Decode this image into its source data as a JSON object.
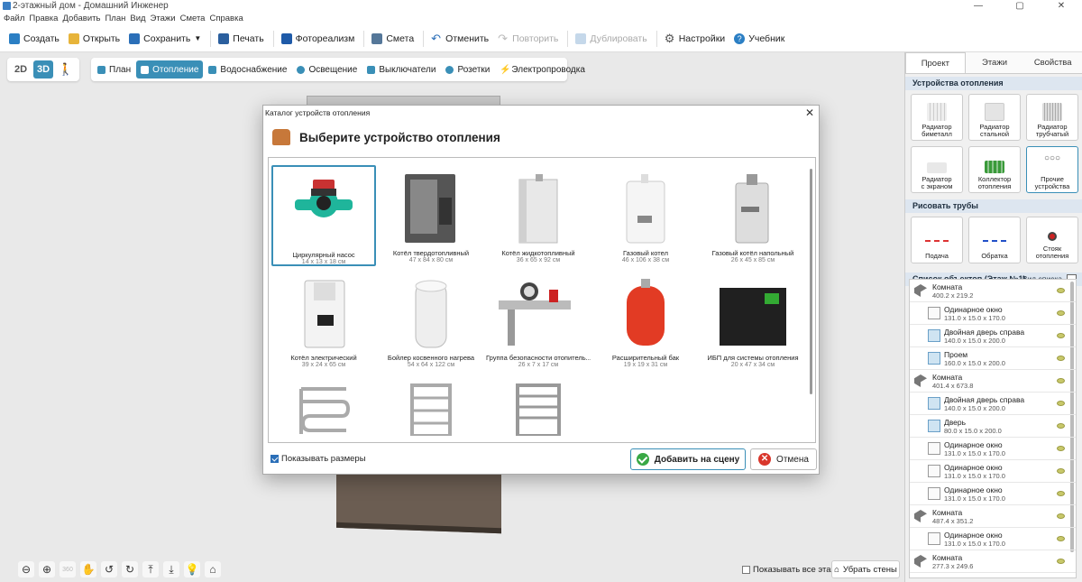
{
  "window": {
    "title": "2-этажный дом - Домашний Инженер",
    "controls": [
      "—",
      "▢",
      "✕"
    ]
  },
  "menu": [
    "Файл",
    "Правка",
    "Добавить",
    "План",
    "Вид",
    "Этажи",
    "Смета",
    "Справка"
  ],
  "toolbar": {
    "create": "Создать",
    "open": "Открыть",
    "save": "Сохранить",
    "print": "Печать",
    "photoreal": "Фотореализм",
    "estimate": "Смета",
    "undo": "Отменить",
    "redo": "Повторить",
    "duplicate": "Дублировать",
    "settings": "Настройки",
    "tutorial": "Учебник"
  },
  "views": {
    "v2d": "2D",
    "v3d": "3D"
  },
  "modes": [
    "План",
    "Отопление",
    "Водоснабжение",
    "Освещение",
    "Выключатели",
    "Розетки",
    "Электропроводка"
  ],
  "bottom": {
    "show_all_floors": "Показывать все этажи",
    "remove_walls": "Убрать стены",
    "rotate_label": "360"
  },
  "right": {
    "tabs": [
      "Проект",
      "Этажи",
      "Свойства"
    ],
    "devices_header": "Устройства отопления",
    "devices": [
      {
        "l1": "Радиатор",
        "l2": "биметалл"
      },
      {
        "l1": "Радиатор",
        "l2": "стальной"
      },
      {
        "l1": "Радиатор",
        "l2": "трубчатый"
      },
      {
        "l1": "Радиатор",
        "l2": "с экраном"
      },
      {
        "l1": "Коллектор",
        "l2": "отопления"
      },
      {
        "l1": "Прочие",
        "l2": "устройства"
      }
    ],
    "pipes_header": "Рисовать трубы",
    "pipes": [
      {
        "l1": "Подача",
        "l2": ""
      },
      {
        "l1": "Обратка",
        "l2": ""
      },
      {
        "l1": "Стояк",
        "l2": "отопления"
      }
    ],
    "objects_header": "Список объектов (Этаж №1)",
    "view_list": "Вид списка",
    "objects": [
      {
        "name": "Комната",
        "dim": "400.2 x 219.2",
        "kind": "room"
      },
      {
        "name": "Одинарное окно",
        "dim": "131.0 x 15.0 x 170.0",
        "kind": "child"
      },
      {
        "name": "Двойная дверь справа",
        "dim": "140.0 x 15.0 x 200.0",
        "kind": "door"
      },
      {
        "name": "Проем",
        "dim": "160.0 x 15.0 x 200.0",
        "kind": "door"
      },
      {
        "name": "Комната",
        "dim": "401.4 x 673.8",
        "kind": "room"
      },
      {
        "name": "Двойная дверь справа",
        "dim": "140.0 x 15.0 x 200.0",
        "kind": "door"
      },
      {
        "name": "Дверь",
        "dim": "80.0 x 15.0 x 200.0",
        "kind": "door"
      },
      {
        "name": "Одинарное окно",
        "dim": "131.0 x 15.0 x 170.0",
        "kind": "child"
      },
      {
        "name": "Одинарное окно",
        "dim": "131.0 x 15.0 x 170.0",
        "kind": "child"
      },
      {
        "name": "Одинарное окно",
        "dim": "131.0 x 15.0 x 170.0",
        "kind": "child"
      },
      {
        "name": "Комната",
        "dim": "487.4 x 351.2",
        "kind": "room"
      },
      {
        "name": "Одинарное окно",
        "dim": "131.0 x 15.0 x 170.0",
        "kind": "child"
      },
      {
        "name": "Комната",
        "dim": "277.3 x 249.6",
        "kind": "room"
      }
    ]
  },
  "dialog": {
    "title": "Каталог устройств отопления",
    "heading": "Выберите устройство отопления",
    "items": [
      {
        "name": "Циркулярный насос",
        "size": "14 x 13 x 18 см",
        "pic": "pump"
      },
      {
        "name": "Котёл твердотопливный",
        "size": "47 x 84 x 80 см",
        "pic": "solid"
      },
      {
        "name": "Котёл жидкотопливный",
        "size": "36 x 65 x 92 см",
        "pic": "liquid"
      },
      {
        "name": "Газовый котел",
        "size": "46 x 106 x 38 см",
        "pic": "gas"
      },
      {
        "name": "Газовый котёл напольный",
        "size": "26 x 45 x 85 см",
        "pic": "gasfloor"
      },
      {
        "name": "Котёл электрический",
        "size": "39 x 24 x 65 см",
        "pic": "electric"
      },
      {
        "name": "Бойлер косвенного нагрева",
        "size": "54 x 64 x 122 см",
        "pic": "boiler"
      },
      {
        "name": "Группа безопасности отопитель...",
        "size": "26 x 7 x 17 см",
        "pic": "safety"
      },
      {
        "name": "Расширительный бак",
        "size": "19 x 19 x 31 см",
        "pic": "tank"
      },
      {
        "name": "ИБП для системы отопления",
        "size": "20 x 47 x 34 см",
        "pic": "ups"
      },
      {
        "name": "",
        "size": "",
        "pic": "towel1"
      },
      {
        "name": "",
        "size": "",
        "pic": "towel2"
      },
      {
        "name": "",
        "size": "",
        "pic": "towel3"
      }
    ],
    "show_sizes": "Показывать размеры",
    "add": "Добавить на сцену",
    "cancel": "Отмена"
  }
}
